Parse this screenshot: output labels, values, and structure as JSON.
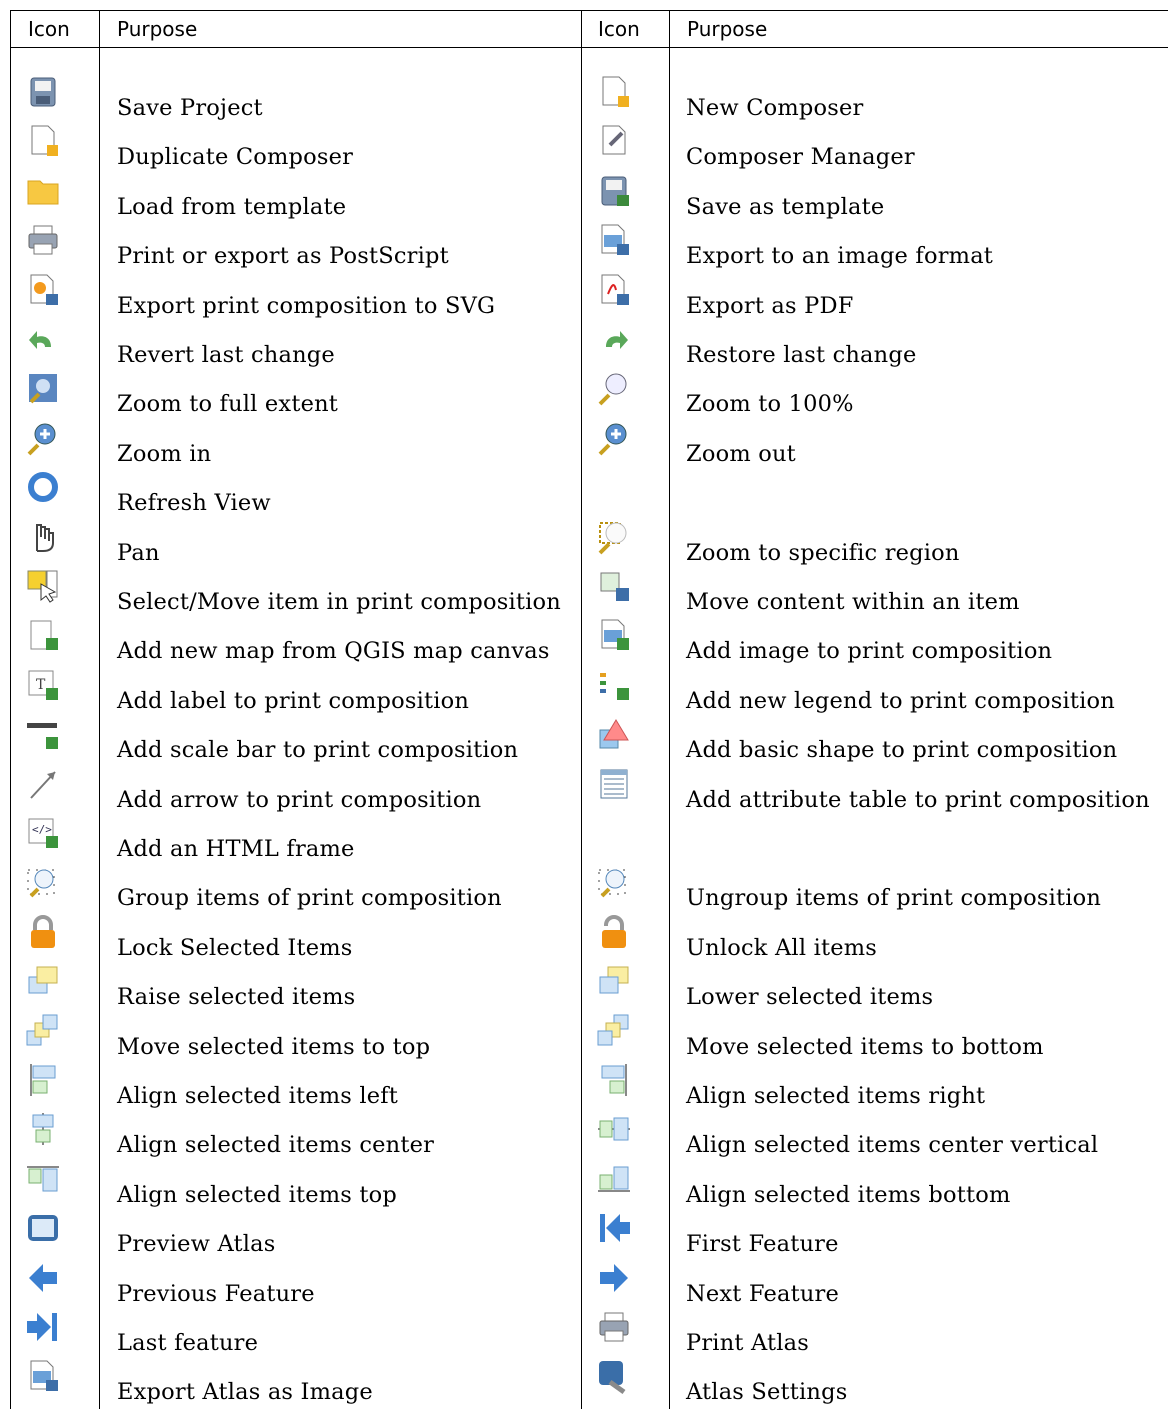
{
  "header": {
    "col1": "Icon",
    "col2": "Purpose",
    "col3": "Icon",
    "col4": "Purpose"
  },
  "rows": [
    {
      "left": {
        "icon": "save-project-icon",
        "label": "Save Project"
      },
      "right": {
        "icon": "new-composer-icon",
        "label": "New Composer"
      }
    },
    {
      "left": {
        "icon": "duplicate-composer-icon",
        "label": "Duplicate Composer"
      },
      "right": {
        "icon": "composer-manager-icon",
        "label": "Composer Manager"
      }
    },
    {
      "left": {
        "icon": "folder-icon",
        "label": "Load from template"
      },
      "right": {
        "icon": "save-template-icon",
        "label": "Save as template"
      }
    },
    {
      "left": {
        "icon": "printer-icon",
        "label": "Print or export as PostScript"
      },
      "right": {
        "icon": "export-image-icon",
        "label": "Export to an image format"
      }
    },
    {
      "left": {
        "icon": "export-svg-icon",
        "label": "Export print composition to SVG"
      },
      "right": {
        "icon": "export-pdf-icon",
        "label": "Export as PDF"
      }
    },
    {
      "left": {
        "icon": "undo-icon",
        "label": "Revert last change"
      },
      "right": {
        "icon": "redo-icon",
        "label": "Restore last change"
      }
    },
    {
      "left": {
        "icon": "zoom-full-extent-icon",
        "label": "Zoom to full extent"
      },
      "right": {
        "icon": "zoom-actual-icon",
        "label": "Zoom to 100%"
      }
    },
    {
      "left": {
        "icon": "zoom-in-icon",
        "label": "Zoom in"
      },
      "right": {
        "icon": "zoom-out-icon",
        "label": "Zoom out"
      }
    },
    {
      "left": {
        "icon": "refresh-icon",
        "label": "Refresh View"
      },
      "right": {
        "icon": "",
        "label": ""
      }
    },
    {
      "left": {
        "icon": "pan-hand-icon",
        "label": "Pan"
      },
      "right": {
        "icon": "zoom-region-icon",
        "label": "Zoom to specific region"
      }
    },
    {
      "left": {
        "icon": "select-move-icon",
        "label": "Select/Move item in print composition"
      },
      "right": {
        "icon": "move-content-icon",
        "label": "Move content within an item"
      }
    },
    {
      "left": {
        "icon": "add-map-icon",
        "label": "Add new map from QGIS map canvas"
      },
      "right": {
        "icon": "add-image-icon",
        "label": "Add image to print composition"
      }
    },
    {
      "left": {
        "icon": "add-label-icon",
        "label": "Add label to print composition"
      },
      "right": {
        "icon": "add-legend-icon",
        "label": "Add new legend to print composition"
      }
    },
    {
      "left": {
        "icon": "add-scalebar-icon",
        "label": "Add scale bar to print composition"
      },
      "right": {
        "icon": "add-shape-icon",
        "label": "Add basic shape to print composition"
      }
    },
    {
      "left": {
        "icon": "add-arrow-icon",
        "label": "Add arrow to print composition"
      },
      "right": {
        "icon": "attribute-table-icon",
        "label": "Add attribute table to print composition"
      }
    },
    {
      "left": {
        "icon": "add-html-icon",
        "label": "Add an HTML frame"
      },
      "right": {
        "icon": "",
        "label": ""
      }
    },
    {
      "left": {
        "icon": "group-items-icon",
        "label": "Group items of print composition"
      },
      "right": {
        "icon": "ungroup-items-icon",
        "label": "Ungroup items of print composition"
      }
    },
    {
      "left": {
        "icon": "lock-icon",
        "label": "Lock Selected Items"
      },
      "right": {
        "icon": "unlock-icon",
        "label": "Unlock All items"
      }
    },
    {
      "left": {
        "icon": "raise-icon",
        "label": "Raise selected items"
      },
      "right": {
        "icon": "lower-icon",
        "label": "Lower selected items"
      }
    },
    {
      "left": {
        "icon": "move-top-icon",
        "label": "Move selected items to top"
      },
      "right": {
        "icon": "move-bottom-icon",
        "label": "Move selected items to bottom"
      }
    },
    {
      "left": {
        "icon": "align-left-icon",
        "label": "Align selected items left"
      },
      "right": {
        "icon": "align-right-icon",
        "label": "Align selected items right"
      }
    },
    {
      "left": {
        "icon": "align-hcenter-icon",
        "label": "Align selected items center"
      },
      "right": {
        "icon": "align-vcenter-icon",
        "label": "Align selected items center vertical"
      }
    },
    {
      "left": {
        "icon": "align-top-icon",
        "label": "Align selected items top"
      },
      "right": {
        "icon": "align-bottom-icon",
        "label": "Align selected items bottom"
      }
    },
    {
      "left": {
        "icon": "atlas-preview-icon",
        "label": "Preview Atlas"
      },
      "right": {
        "icon": "first-feature-icon",
        "label": "First Feature"
      }
    },
    {
      "left": {
        "icon": "previous-feature-icon",
        "label": "Previous Feature"
      },
      "right": {
        "icon": "next-feature-icon",
        "label": "Next Feature"
      }
    },
    {
      "left": {
        "icon": "last-feature-icon",
        "label": "Last feature"
      },
      "right": {
        "icon": "print-atlas-icon",
        "label": "Print Atlas"
      }
    },
    {
      "left": {
        "icon": "export-atlas-image-icon",
        "label": "Export Atlas as Image"
      },
      "right": {
        "icon": "atlas-settings-icon",
        "label": "Atlas Settings"
      }
    }
  ]
}
